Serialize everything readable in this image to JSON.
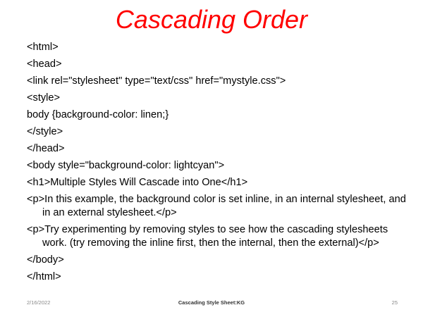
{
  "slide": {
    "title": "Cascading Order",
    "title_color": "#ff0000"
  },
  "code_lines": [
    "<html>",
    "<head>",
    "<link rel=\"stylesheet\" type=\"text/css\" href=\"mystyle.css\">",
    "<style>",
    "body {background-color: linen;}",
    "</style>",
    "</head>",
    "<body style=\"background-color: lightcyan\">",
    "<h1>Multiple Styles Will Cascade into One</h1>",
    "<p>In this example, the background color is set inline, in an internal stylesheet, and in an external stylesheet.</p>",
    "<p>Try experimenting by removing styles to see how the cascading stylesheets work. (try removing the inline first, then the internal, then the external)</p>",
    "</body>",
    "</html>"
  ],
  "footer": {
    "date": "2/16/2022",
    "center": "Cascading  Style Sheet:KG",
    "page": "25"
  }
}
